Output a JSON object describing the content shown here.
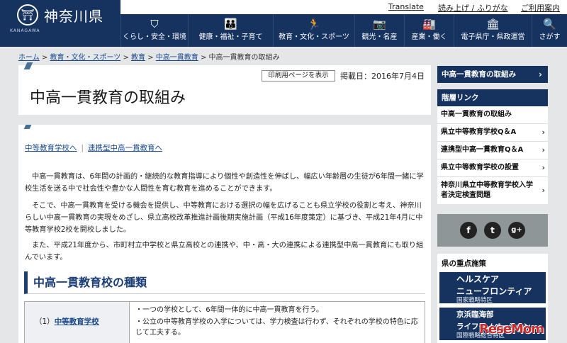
{
  "utility": {
    "translate": "Translate",
    "read_aloud": "読み上げ / ふりがな",
    "guide": "ご利用案内"
  },
  "header": {
    "logo_text": "神奈川県",
    "logo_sub": "KANAGAWA",
    "nav": [
      {
        "icon": "shield-icon",
        "glyph": "⛉",
        "label": "くらし・安全・環境"
      },
      {
        "icon": "family-icon",
        "glyph": "👪",
        "label": "健康・福祉・子育て"
      },
      {
        "icon": "runner-icon",
        "glyph": "🏃",
        "label": "教育・文化・スポーツ"
      },
      {
        "icon": "camera-icon",
        "glyph": "📷",
        "label": "観光・名産"
      },
      {
        "icon": "factory-icon",
        "glyph": "🏭",
        "label": "産業・働く"
      },
      {
        "icon": "building-icon",
        "glyph": "🏛",
        "label": "電子県庁・県政運営"
      },
      {
        "icon": "search-icon",
        "glyph": "🔍",
        "label": "さがす"
      }
    ]
  },
  "breadcrumb": {
    "home": "ホーム",
    "sep": " > ",
    "c1": "教育・文化・スポーツ",
    "c2": "教育",
    "c3": "中高一貫教育",
    "current": "中高一貫教育の取組み"
  },
  "title_card": {
    "print_label": "印刷用ページを表示",
    "published": "掲載日：2016年7月4日",
    "title": "中高一貫教育の取組み"
  },
  "content": {
    "link1": "中等教育学校へ",
    "link_sep": "|",
    "link2": "連携型中高一貫教育へ",
    "p1": "中高一貫教育は、6年間の計画的・継続的な教育指導により個性や創造性を伸ばし、幅広い年齢層の生徒が6年間一緒に学校生活を送る中で社会性や豊かな人間性を育む教育を進めることができます。",
    "p2": "そこで、中高一貫教育を受ける機会を提供し、中等教育における選択の幅を広げることも県立学校の役割と考え、神奈川らしい中高一貫教育の実現をめざし、県立高校改革推進計画後期実施計画（平成16年度策定）に基づき、平成21年4月に中等教育学校2校を開校しました。",
    "p3": "また、平成21年度から、市町村立中学校と県立高校との連携や、中・高・大の連携による連携型中高一貫教育にも取り組んでいます。",
    "h2": "中高一貫教育校の種類",
    "row1_num": "（1）",
    "row1_head": "中等教育学校",
    "row1_b1": "・一つの学校として、6年間一体的に中高一貫教育を行う。",
    "row1_b2": "・公立の中等教育学校の入学については、学力検査は行わず、それぞれの学校の特色に応じて工夫する。"
  },
  "sidebar": {
    "top": "中高一貫教育の取組み",
    "head": "階層リンク",
    "items": [
      "中高一貫教育の取組み",
      "県立中等教育学校Q＆A",
      "連携型中高一貫教育Q＆A",
      "県立中等教育学校の設置",
      "神奈川県立中等教育学校入学者決定検査問題"
    ],
    "social": [
      {
        "icon": "facebook-icon",
        "glyph": "f"
      },
      {
        "icon": "twitter-icon",
        "glyph": "t"
      },
      {
        "icon": "googleplus-icon",
        "glyph": "g+"
      }
    ],
    "policy_title": "県の重点施策",
    "banner1_l1": "ヘルスケア",
    "banner1_l2": "ニューフロンティア",
    "banner1_sub": "国家戦略特区",
    "banner2_l1": "京浜臨海部",
    "banner2_l2": "ライフイノベーション",
    "banner2_sub": "国際戦略総合特区"
  },
  "watermark": "ReseMom"
}
